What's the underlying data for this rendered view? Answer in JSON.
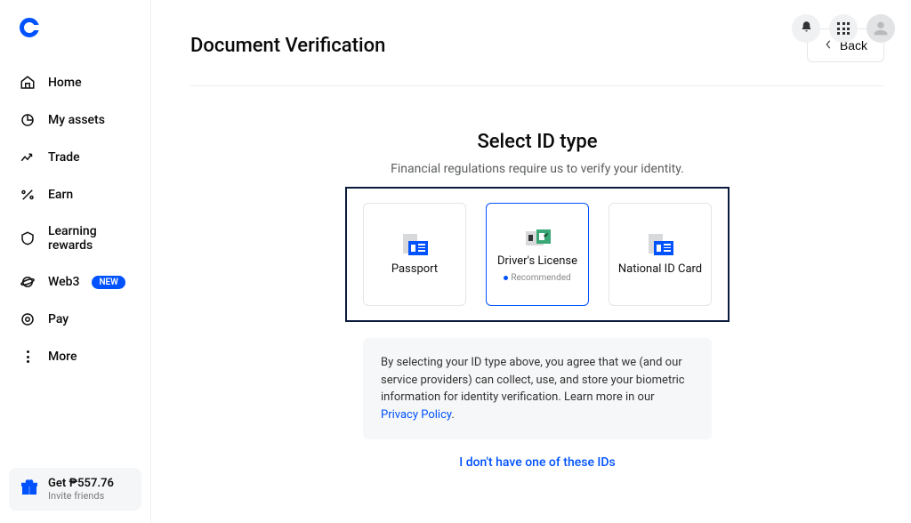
{
  "sidebar": {
    "items": [
      {
        "label": "Home"
      },
      {
        "label": "My assets"
      },
      {
        "label": "Trade"
      },
      {
        "label": "Earn"
      },
      {
        "label": "Learning rewards"
      },
      {
        "label": "Web3",
        "badge": "NEW"
      },
      {
        "label": "Pay"
      },
      {
        "label": "More"
      }
    ],
    "invite": {
      "title": "Get ₱557.76",
      "subtitle": "Invite friends"
    }
  },
  "header": {
    "page_title": "Document Verification",
    "back_label": "Back"
  },
  "id_select": {
    "heading": "Select ID type",
    "subtext": "Financial regulations require us to verify your identity.",
    "options": {
      "passport": "Passport",
      "drivers_license": "Driver's License",
      "national_id": "National ID Card",
      "recommended_label": "Recommended"
    },
    "consent_prefix": "By selecting your ID type above, you agree that we (and our service providers) can collect, use, and store your biometric information for identity verification. Learn more in our ",
    "consent_link": "Privacy Policy",
    "consent_suffix": ".",
    "no_id_link": "I don't have one of these IDs"
  }
}
